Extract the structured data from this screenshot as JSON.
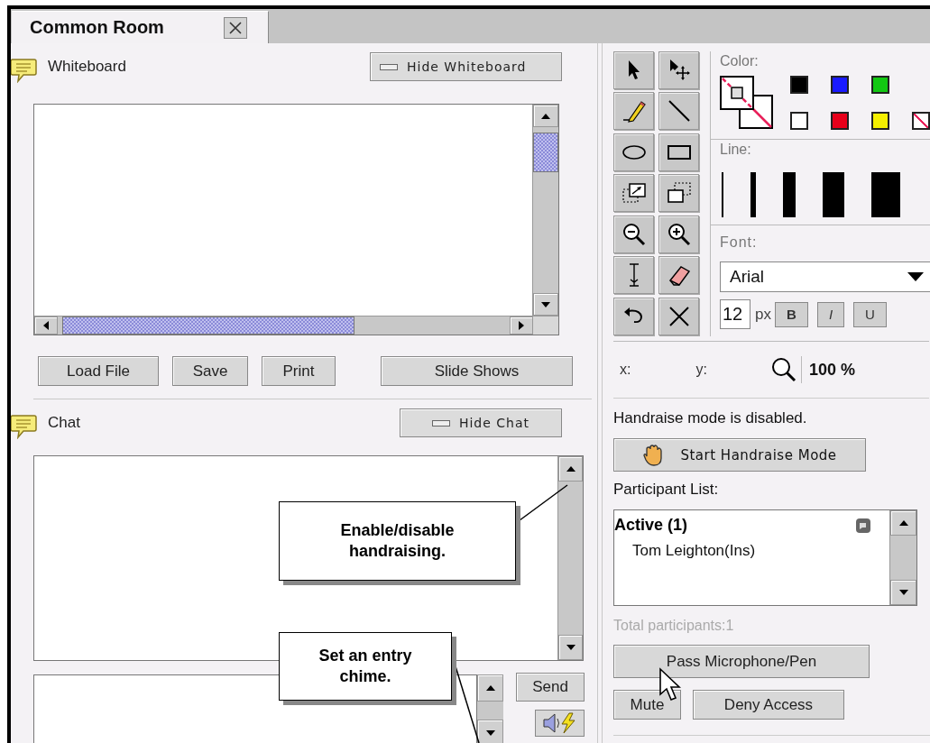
{
  "tabs": [
    {
      "label": "Common Room",
      "selected": true
    }
  ],
  "whiteboard": {
    "title": "Whiteboard",
    "hide_button": "Hide Whiteboard",
    "buttons": [
      "Load File",
      "Save",
      "Print",
      "Slide Shows"
    ]
  },
  "chat": {
    "title": "Chat",
    "hide_button": "Hide Chat",
    "send_button": "Send"
  },
  "color": {
    "label": "Color:",
    "swatch_rows": [
      [
        {
          "kind": "color",
          "color": "#000000"
        },
        {
          "kind": "color",
          "color": "#1a1aff"
        },
        {
          "kind": "color",
          "color": "#12c812"
        }
      ],
      [
        {
          "kind": "color",
          "color": "#ffffff"
        },
        {
          "kind": "color",
          "color": "#e8001a"
        },
        {
          "kind": "color",
          "color": "#f5f000"
        },
        {
          "kind": "none"
        }
      ]
    ]
  },
  "line": {
    "label": "Line:"
  },
  "font": {
    "label": "Font:",
    "value": "Arial",
    "size": "12",
    "unit": "px",
    "style_buttons": [
      {
        "label": "B",
        "kind": "bold"
      },
      {
        "label": "I",
        "kind": "italic"
      },
      {
        "label": "U",
        "kind": "underline"
      }
    ]
  },
  "coordinates": {
    "x_label": "x:",
    "y_label": "y:",
    "zoom": "100 %"
  },
  "handraise": {
    "status": "Handraise mode is disabled.",
    "button": "Start Handraise Mode"
  },
  "participants": {
    "label": "Participant List:",
    "groups": [
      {
        "title": "Active (1)",
        "children": [
          {
            "name": "Tom Leighton(Ins)"
          }
        ]
      }
    ],
    "total": "Total participants:1"
  },
  "actions": {
    "pass_button": "Pass Microphone/Pen",
    "buttons": [
      "Mute",
      "Deny Access"
    ]
  },
  "callouts": [
    {
      "kind": "handraise",
      "text": "Enable/disable handraising."
    },
    {
      "kind": "chime",
      "text": "Set an entry chime."
    }
  ]
}
